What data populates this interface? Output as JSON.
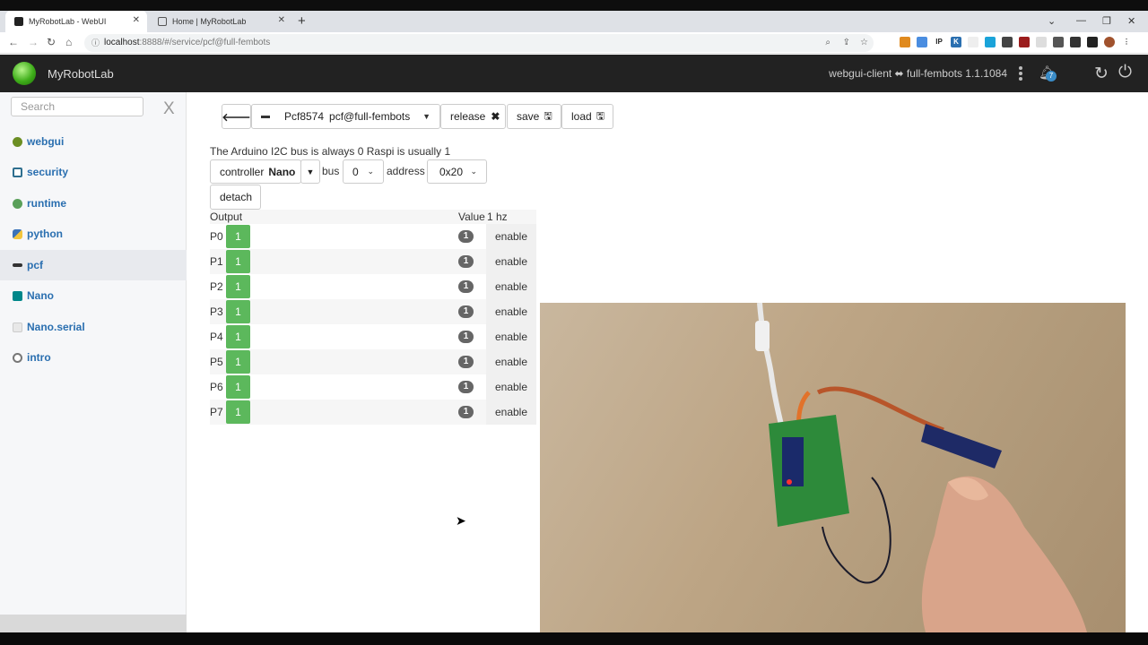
{
  "browser": {
    "tabs": [
      {
        "title": "MyRobotLab - WebUI"
      },
      {
        "title": "Home | MyRobotLab"
      }
    ],
    "url_host": "localhost",
    "url_rest": ":8888/#/service/pcf@full-fembots"
  },
  "app": {
    "title": "MyRobotLab",
    "connection": "webgui-client ⬌ full-fembots 1.1.1084",
    "notification_count": "7"
  },
  "sidebar": {
    "search_placeholder": "Search",
    "clear_label": "X",
    "items": [
      {
        "label": "webgui",
        "icon": "globe-icon",
        "color": "#6b8e23"
      },
      {
        "label": "security",
        "icon": "security-icon",
        "color": "#2f6f8f"
      },
      {
        "label": "runtime",
        "icon": "runtime-icon",
        "color": "#5aa05a"
      },
      {
        "label": "python",
        "icon": "python-icon",
        "color": "#3b73b9"
      },
      {
        "label": "pcf",
        "icon": "pcf-chip-icon",
        "color": "#333333"
      },
      {
        "label": "Nano",
        "icon": "arduino-icon",
        "color": "#00878a"
      },
      {
        "label": "Nano.serial",
        "icon": "serial-icon",
        "color": "#cccccc"
      },
      {
        "label": "intro",
        "icon": "intro-icon",
        "color": "#777777"
      }
    ]
  },
  "toolbar": {
    "service_type": "Pcf8574",
    "service_name": "pcf@full-fembots",
    "release_label": "release",
    "save_label": "save",
    "load_label": "load"
  },
  "config": {
    "info": "The Arduino I2C bus is always 0 Raspi is usually 1",
    "controller_label": "controller",
    "controller_value": "Nano",
    "bus_label": "bus",
    "bus_value": "0",
    "address_label": "address",
    "address_value": "0x20",
    "detach_label": "detach"
  },
  "table": {
    "output_header": "Output",
    "value_header": "Value",
    "rate": "1 hz",
    "rows": [
      {
        "pin": "P0",
        "value": "1",
        "badge": "1",
        "action": "enable"
      },
      {
        "pin": "P1",
        "value": "1",
        "badge": "1",
        "action": "enable"
      },
      {
        "pin": "P2",
        "value": "1",
        "badge": "1",
        "action": "enable"
      },
      {
        "pin": "P3",
        "value": "1",
        "badge": "1",
        "action": "enable"
      },
      {
        "pin": "P4",
        "value": "1",
        "badge": "1",
        "action": "enable"
      },
      {
        "pin": "P5",
        "value": "1",
        "badge": "1",
        "action": "enable"
      },
      {
        "pin": "P6",
        "value": "1",
        "badge": "1",
        "action": "enable"
      },
      {
        "pin": "P7",
        "value": "1",
        "badge": "1",
        "action": "enable"
      }
    ]
  },
  "colors": {
    "pin_high": "#5cb85c",
    "link": "#2a6fb0",
    "header_bg": "#222222"
  }
}
